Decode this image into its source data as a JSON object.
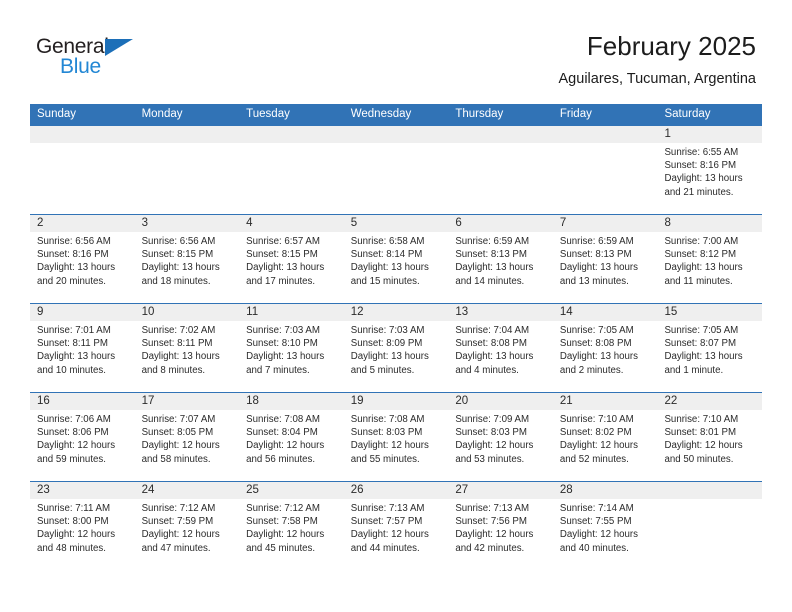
{
  "logo": {
    "word_dark": "General",
    "word_blue": "Blue",
    "triangle_color": "#1c6fb8"
  },
  "header": {
    "title": "February 2025",
    "subtitle": "Aguilares, Tucuman, Argentina"
  },
  "colors": {
    "header_blue": "#3173b6",
    "daynum_band": "#efefef",
    "text": "#2b2b2b"
  },
  "weekdays": [
    "Sunday",
    "Monday",
    "Tuesday",
    "Wednesday",
    "Thursday",
    "Friday",
    "Saturday"
  ],
  "weeks": [
    [
      {
        "day": "",
        "sunrise": "",
        "sunset": "",
        "daylight1": "",
        "daylight2": ""
      },
      {
        "day": "",
        "sunrise": "",
        "sunset": "",
        "daylight1": "",
        "daylight2": ""
      },
      {
        "day": "",
        "sunrise": "",
        "sunset": "",
        "daylight1": "",
        "daylight2": ""
      },
      {
        "day": "",
        "sunrise": "",
        "sunset": "",
        "daylight1": "",
        "daylight2": ""
      },
      {
        "day": "",
        "sunrise": "",
        "sunset": "",
        "daylight1": "",
        "daylight2": ""
      },
      {
        "day": "",
        "sunrise": "",
        "sunset": "",
        "daylight1": "",
        "daylight2": ""
      },
      {
        "day": "1",
        "sunrise": "Sunrise: 6:55 AM",
        "sunset": "Sunset: 8:16 PM",
        "daylight1": "Daylight: 13 hours",
        "daylight2": "and 21 minutes."
      }
    ],
    [
      {
        "day": "2",
        "sunrise": "Sunrise: 6:56 AM",
        "sunset": "Sunset: 8:16 PM",
        "daylight1": "Daylight: 13 hours",
        "daylight2": "and 20 minutes."
      },
      {
        "day": "3",
        "sunrise": "Sunrise: 6:56 AM",
        "sunset": "Sunset: 8:15 PM",
        "daylight1": "Daylight: 13 hours",
        "daylight2": "and 18 minutes."
      },
      {
        "day": "4",
        "sunrise": "Sunrise: 6:57 AM",
        "sunset": "Sunset: 8:15 PM",
        "daylight1": "Daylight: 13 hours",
        "daylight2": "and 17 minutes."
      },
      {
        "day": "5",
        "sunrise": "Sunrise: 6:58 AM",
        "sunset": "Sunset: 8:14 PM",
        "daylight1": "Daylight: 13 hours",
        "daylight2": "and 15 minutes."
      },
      {
        "day": "6",
        "sunrise": "Sunrise: 6:59 AM",
        "sunset": "Sunset: 8:13 PM",
        "daylight1": "Daylight: 13 hours",
        "daylight2": "and 14 minutes."
      },
      {
        "day": "7",
        "sunrise": "Sunrise: 6:59 AM",
        "sunset": "Sunset: 8:13 PM",
        "daylight1": "Daylight: 13 hours",
        "daylight2": "and 13 minutes."
      },
      {
        "day": "8",
        "sunrise": "Sunrise: 7:00 AM",
        "sunset": "Sunset: 8:12 PM",
        "daylight1": "Daylight: 13 hours",
        "daylight2": "and 11 minutes."
      }
    ],
    [
      {
        "day": "9",
        "sunrise": "Sunrise: 7:01 AM",
        "sunset": "Sunset: 8:11 PM",
        "daylight1": "Daylight: 13 hours",
        "daylight2": "and 10 minutes."
      },
      {
        "day": "10",
        "sunrise": "Sunrise: 7:02 AM",
        "sunset": "Sunset: 8:11 PM",
        "daylight1": "Daylight: 13 hours",
        "daylight2": "and 8 minutes."
      },
      {
        "day": "11",
        "sunrise": "Sunrise: 7:03 AM",
        "sunset": "Sunset: 8:10 PM",
        "daylight1": "Daylight: 13 hours",
        "daylight2": "and 7 minutes."
      },
      {
        "day": "12",
        "sunrise": "Sunrise: 7:03 AM",
        "sunset": "Sunset: 8:09 PM",
        "daylight1": "Daylight: 13 hours",
        "daylight2": "and 5 minutes."
      },
      {
        "day": "13",
        "sunrise": "Sunrise: 7:04 AM",
        "sunset": "Sunset: 8:08 PM",
        "daylight1": "Daylight: 13 hours",
        "daylight2": "and 4 minutes."
      },
      {
        "day": "14",
        "sunrise": "Sunrise: 7:05 AM",
        "sunset": "Sunset: 8:08 PM",
        "daylight1": "Daylight: 13 hours",
        "daylight2": "and 2 minutes."
      },
      {
        "day": "15",
        "sunrise": "Sunrise: 7:05 AM",
        "sunset": "Sunset: 8:07 PM",
        "daylight1": "Daylight: 13 hours",
        "daylight2": "and 1 minute."
      }
    ],
    [
      {
        "day": "16",
        "sunrise": "Sunrise: 7:06 AM",
        "sunset": "Sunset: 8:06 PM",
        "daylight1": "Daylight: 12 hours",
        "daylight2": "and 59 minutes."
      },
      {
        "day": "17",
        "sunrise": "Sunrise: 7:07 AM",
        "sunset": "Sunset: 8:05 PM",
        "daylight1": "Daylight: 12 hours",
        "daylight2": "and 58 minutes."
      },
      {
        "day": "18",
        "sunrise": "Sunrise: 7:08 AM",
        "sunset": "Sunset: 8:04 PM",
        "daylight1": "Daylight: 12 hours",
        "daylight2": "and 56 minutes."
      },
      {
        "day": "19",
        "sunrise": "Sunrise: 7:08 AM",
        "sunset": "Sunset: 8:03 PM",
        "daylight1": "Daylight: 12 hours",
        "daylight2": "and 55 minutes."
      },
      {
        "day": "20",
        "sunrise": "Sunrise: 7:09 AM",
        "sunset": "Sunset: 8:03 PM",
        "daylight1": "Daylight: 12 hours",
        "daylight2": "and 53 minutes."
      },
      {
        "day": "21",
        "sunrise": "Sunrise: 7:10 AM",
        "sunset": "Sunset: 8:02 PM",
        "daylight1": "Daylight: 12 hours",
        "daylight2": "and 52 minutes."
      },
      {
        "day": "22",
        "sunrise": "Sunrise: 7:10 AM",
        "sunset": "Sunset: 8:01 PM",
        "daylight1": "Daylight: 12 hours",
        "daylight2": "and 50 minutes."
      }
    ],
    [
      {
        "day": "23",
        "sunrise": "Sunrise: 7:11 AM",
        "sunset": "Sunset: 8:00 PM",
        "daylight1": "Daylight: 12 hours",
        "daylight2": "and 48 minutes."
      },
      {
        "day": "24",
        "sunrise": "Sunrise: 7:12 AM",
        "sunset": "Sunset: 7:59 PM",
        "daylight1": "Daylight: 12 hours",
        "daylight2": "and 47 minutes."
      },
      {
        "day": "25",
        "sunrise": "Sunrise: 7:12 AM",
        "sunset": "Sunset: 7:58 PM",
        "daylight1": "Daylight: 12 hours",
        "daylight2": "and 45 minutes."
      },
      {
        "day": "26",
        "sunrise": "Sunrise: 7:13 AM",
        "sunset": "Sunset: 7:57 PM",
        "daylight1": "Daylight: 12 hours",
        "daylight2": "and 44 minutes."
      },
      {
        "day": "27",
        "sunrise": "Sunrise: 7:13 AM",
        "sunset": "Sunset: 7:56 PM",
        "daylight1": "Daylight: 12 hours",
        "daylight2": "and 42 minutes."
      },
      {
        "day": "28",
        "sunrise": "Sunrise: 7:14 AM",
        "sunset": "Sunset: 7:55 PM",
        "daylight1": "Daylight: 12 hours",
        "daylight2": "and 40 minutes."
      },
      {
        "day": "",
        "sunrise": "",
        "sunset": "",
        "daylight1": "",
        "daylight2": ""
      }
    ]
  ]
}
